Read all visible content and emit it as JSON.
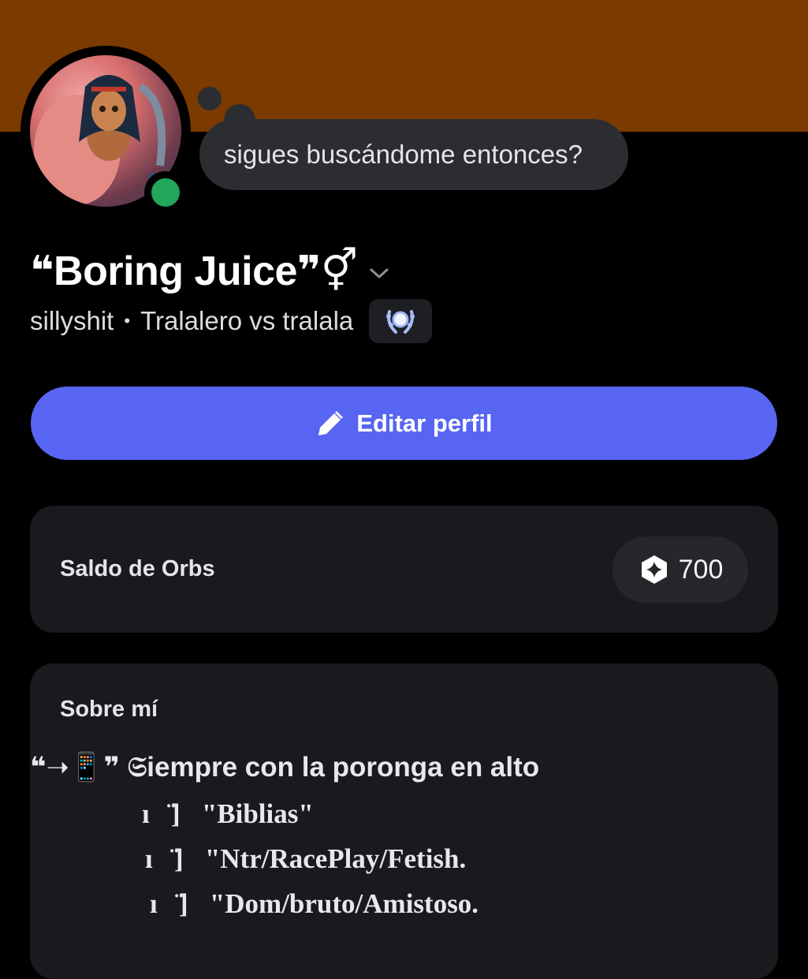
{
  "colors": {
    "banner": "#7b3a00",
    "accent_button": "#5865f2",
    "status_online": "#23a55a"
  },
  "profile": {
    "avatar_icon": "anime-avatar",
    "status": "online",
    "custom_status": "sigues buscándome entonces?",
    "display_name": "❝Boring Juice❞⚥",
    "username": "sillyshit",
    "separator": "•",
    "pronouns": "Tralalero vs tralala",
    "badge_icon": "laurel-badge-icon"
  },
  "actions": {
    "edit_label": "Editar perfil"
  },
  "orbs": {
    "label": "Saldo de Orbs",
    "value": "700"
  },
  "about": {
    "title": "Sobre mí",
    "lines": [
      "❝➝📱❞ 𝔖iempre con la poronga en alto",
      "ıⓞ̈]✎\"Biblias\"",
      "ıⓞ̈]✎\"Ntr/RacePlay/Fetish.",
      "ıⓞ̈]✎\"Dom/bruto/Amistoso."
    ]
  }
}
